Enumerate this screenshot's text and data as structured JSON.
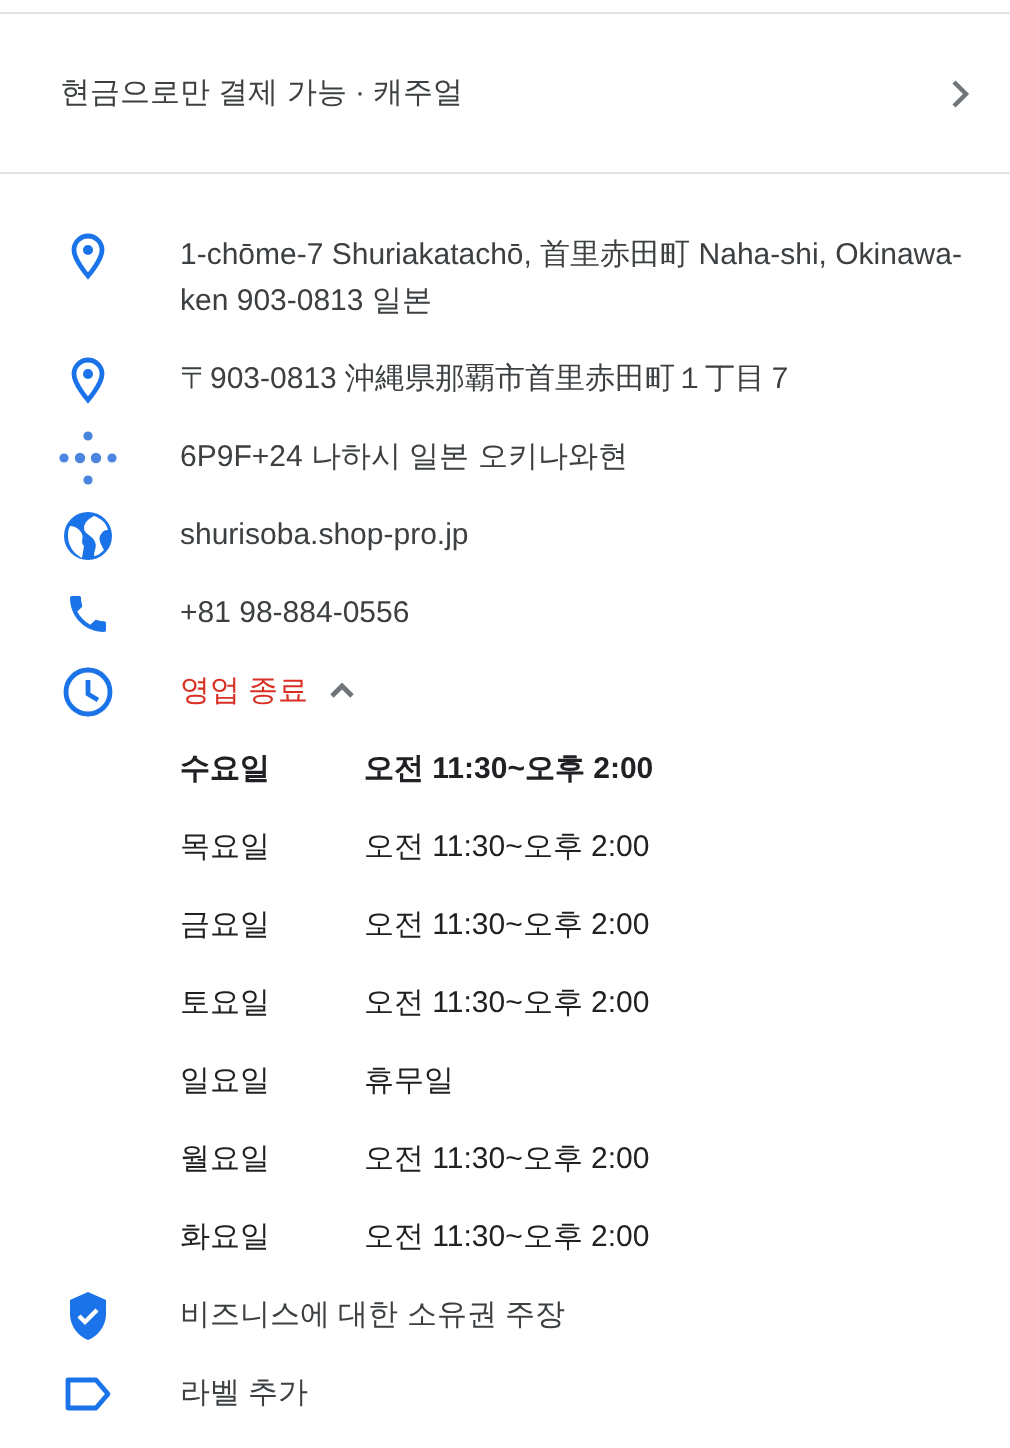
{
  "summary": {
    "text": "현금으로만 결제 가능 · 캐주얼"
  },
  "info_rows": [
    {
      "kind": "address",
      "text": "1-chōme-7 Shuriakatachō, 首里赤田町 Naha-shi, Okinawa-ken 903-0813 일본"
    },
    {
      "kind": "address",
      "text": "〒903-0813 沖縄県那覇市首里赤田町１丁目７"
    },
    {
      "kind": "plus_code",
      "text": "6P9F+24 나하시 일본 오키나와현"
    },
    {
      "kind": "website",
      "text": "shurisoba.shop-pro.jp"
    },
    {
      "kind": "phone",
      "text": "+81 98-884-0556"
    }
  ],
  "hours": {
    "status": "영업 종료",
    "expanded": true,
    "days": [
      {
        "day": "수요일",
        "time": "오전 11:30~오후 2:00",
        "selected": true
      },
      {
        "day": "목요일",
        "time": "오전 11:30~오후 2:00",
        "selected": false
      },
      {
        "day": "금요일",
        "time": "오전 11:30~오후 2:00",
        "selected": false
      },
      {
        "day": "토요일",
        "time": "오전 11:30~오후 2:00",
        "selected": false
      },
      {
        "day": "일요일",
        "time": "휴무일",
        "selected": false
      },
      {
        "day": "월요일",
        "time": "오전 11:30~오후 2:00",
        "selected": false
      },
      {
        "day": "화요일",
        "time": "오전 11:30~오후 2:00",
        "selected": false
      }
    ]
  },
  "action_rows": [
    {
      "kind": "claim",
      "text": "비즈니스에 대한 소유권 주장"
    },
    {
      "kind": "label",
      "text": "라벨 추가"
    }
  ]
}
